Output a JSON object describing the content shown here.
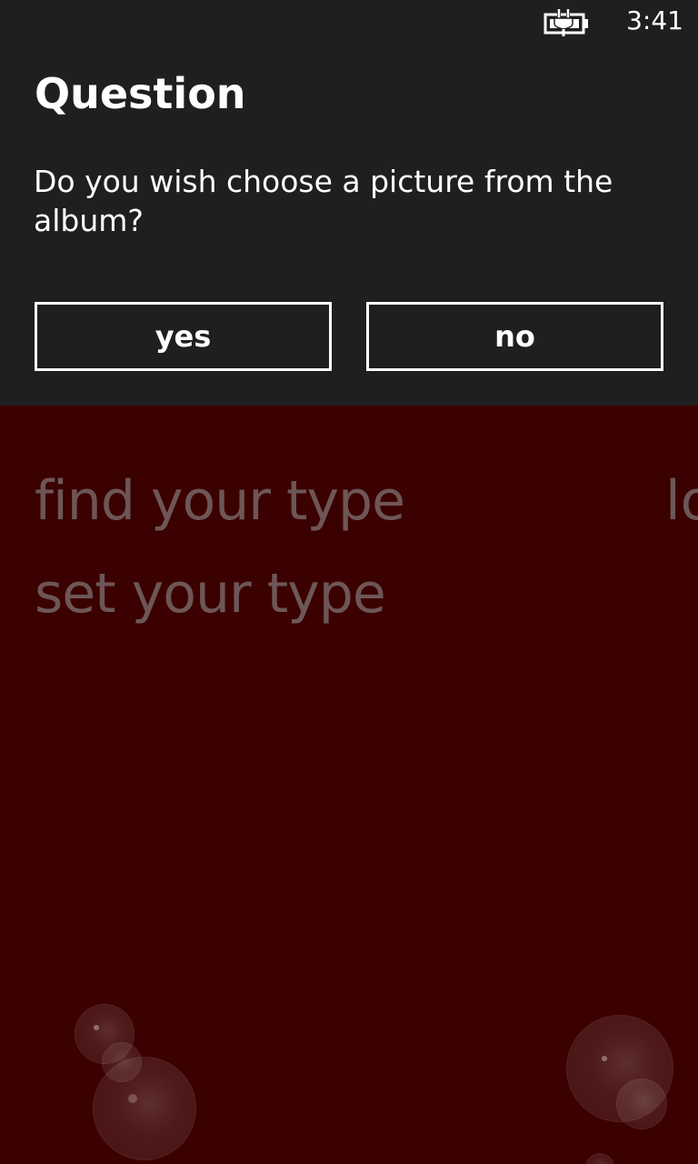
{
  "status_bar": {
    "time": "3:41",
    "battery_icon": "battery-charging-icon"
  },
  "dialog": {
    "title": "Question",
    "message": "Do you wish choose a picture from the album?",
    "yes_label": "yes",
    "no_label": "no"
  },
  "background_app": {
    "menu_items": [
      "find your type",
      "set your type"
    ],
    "peek_text": "lo"
  },
  "colors": {
    "dialog_bg": "#1f1f1f",
    "app_bg": "#3b0000",
    "dim_text": "#6e5656",
    "accent": "#ffffff"
  }
}
